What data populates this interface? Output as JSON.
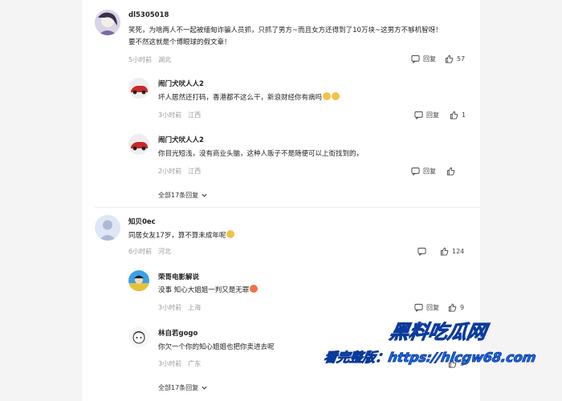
{
  "comments": [
    {
      "user": "dl5305018",
      "text_line1": "笑死，为啥两人不一起被缅甸诈骗人员抓，只抓了男方~而且女方还得到了10万块~这男方不够机智呀！",
      "text_line2": "要不然这就是个博眼球的假文章！",
      "time": "5小时前",
      "location": "湖北",
      "reply_label": "回复",
      "likes": "57",
      "replies": [
        {
          "user": "闹门犬吠人人2",
          "text": "坏人居然还打码，香港都不这么干，新浪财经你有病吗",
          "time": "3小时前",
          "location": "江西",
          "reply_label": "回复",
          "likes": "1"
        },
        {
          "user": "闹门犬吠人人2",
          "text": "你目光短浅，没有商业头脑，这种人贩子不是随便可以上街找到的，",
          "time": "2小时前",
          "location": "江西",
          "reply_label": "回复",
          "likes": ""
        }
      ],
      "expand_label": "全部17条回复"
    },
    {
      "user": "知贝0ec",
      "text": "同居女友17岁，算不算未成年呢",
      "time": "6小时前",
      "location": "河北",
      "reply_label": "",
      "likes": "124",
      "replies": [
        {
          "user": "荣哥电影解说",
          "text": "没事 知心大姐姐一判又是无罪",
          "time": "3小时前",
          "location": "上海",
          "reply_label": "回复",
          "likes": "9"
        },
        {
          "user": "林自若gogo",
          "text": "你欠一个你的知心姐姐也把你卖进去呢",
          "time": "3小时前",
          "location": "广东",
          "reply_label": "",
          "likes": "3"
        }
      ],
      "expand_label": "全部17条回复"
    }
  ],
  "watermark": {
    "logo": "黑料吃瓜网",
    "text": "看完整版：https://hlcgw68.com"
  },
  "colors": {
    "accent": "#1d6df0",
    "meta": "#999999"
  }
}
